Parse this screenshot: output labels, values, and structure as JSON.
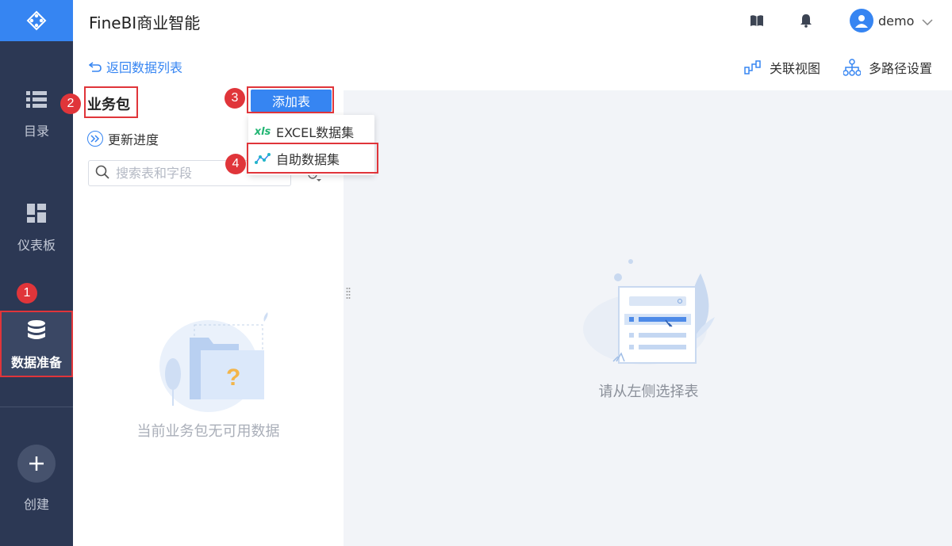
{
  "app": {
    "title": "FineBI商业智能"
  },
  "sidebar": {
    "items": [
      {
        "label": "目录",
        "icon": "list-icon"
      },
      {
        "label": "仪表板",
        "icon": "dashboard-icon"
      },
      {
        "label": "数据准备",
        "icon": "database-icon"
      },
      {
        "label": "创建",
        "icon": "plus-icon"
      }
    ],
    "active": "数据准备"
  },
  "header": {
    "user": "demo"
  },
  "left_panel": {
    "back_label": "返回数据列表",
    "title": "业务包",
    "update_label": "更新进度",
    "search_placeholder": "搜索表和字段",
    "empty_message": "当前业务包无可用数据"
  },
  "add_table": {
    "button_label": "添加表",
    "menu": [
      {
        "icon_text": "xls",
        "label": "EXCEL数据集"
      },
      {
        "label": "自助数据集"
      }
    ]
  },
  "toolbar": {
    "relation_view": "关联视图",
    "multipath": "多路径设置"
  },
  "main": {
    "empty_message": "请从左侧选择表"
  },
  "annotations": [
    "1",
    "2",
    "3",
    "4"
  ],
  "colors": {
    "accent": "#3685f2",
    "sidebar": "#2c3854",
    "highlight": "#e0353a"
  }
}
